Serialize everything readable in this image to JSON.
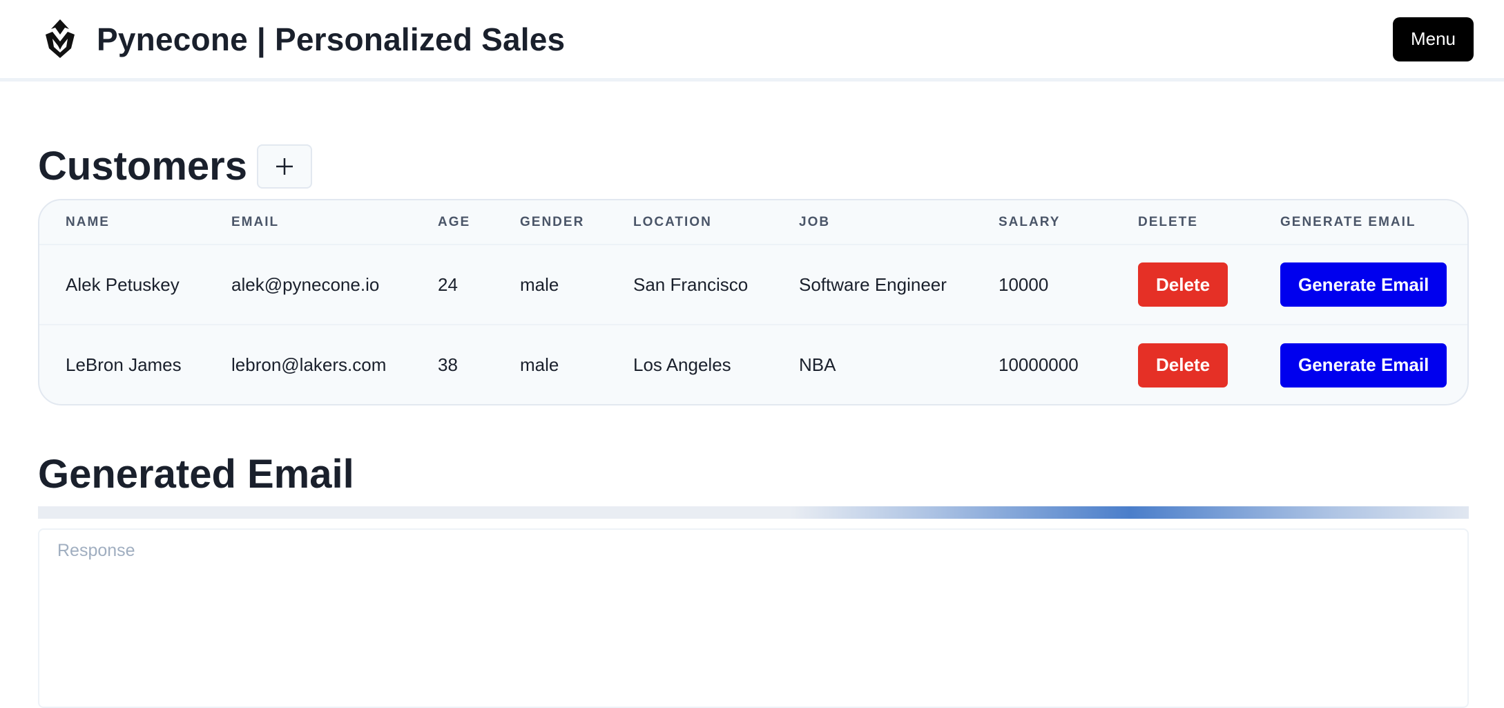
{
  "header": {
    "title": "Pynecone | Personalized Sales",
    "logo_icon": "pynecone-logo-icon",
    "menu_label": "Menu"
  },
  "customers": {
    "title": "Customers",
    "add_icon": "plus-icon",
    "columns": [
      "Name",
      "Email",
      "Age",
      "Gender",
      "Location",
      "Job",
      "Salary",
      "Delete",
      "Generate Email"
    ],
    "rows": [
      {
        "name": "Alek Petuskey",
        "email": "alek@pynecone.io",
        "age": "24",
        "gender": "male",
        "location": "San Francisco",
        "job": "Software Engineer",
        "salary": "10000",
        "delete_label": "Delete",
        "generate_label": "Generate Email"
      },
      {
        "name": "LeBron James",
        "email": "lebron@lakers.com",
        "age": "38",
        "gender": "male",
        "location": "Los Angeles",
        "job": "NBA",
        "salary": "10000000",
        "delete_label": "Delete",
        "generate_label": "Generate Email"
      }
    ]
  },
  "generated_email": {
    "title": "Generated Email",
    "progress_state": "indeterminate",
    "response_placeholder": "Response",
    "response_value": ""
  },
  "colors": {
    "delete": "#e53026",
    "generate": "#0000ee",
    "menu": "#000000",
    "progress": "#4278c8"
  }
}
